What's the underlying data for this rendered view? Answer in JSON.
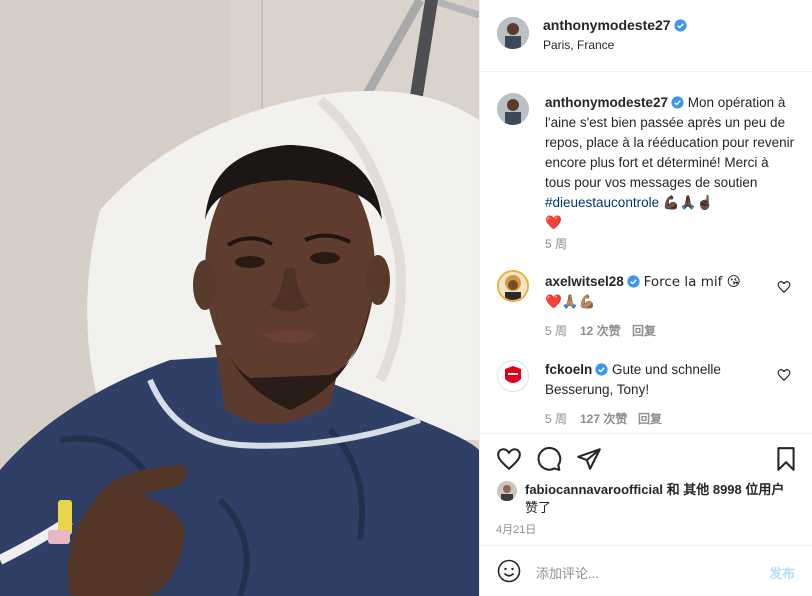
{
  "post": {
    "author": "anthonymodeste27",
    "location": "Paris, France"
  },
  "caption": {
    "author": "anthonymodeste27",
    "text": "Mon opération à l'aine s'est bien passée après un peu de repos, place à la rééducation pour revenir encore plus fort et déterminé! Merci à tous pour vos messages de soutien",
    "hashtag": "#dieuestaucontrole",
    "emojis": "💪🏿🙏🏿☝🏿",
    "emoji_line2": "❤️",
    "time": "5 周"
  },
  "comments": [
    {
      "author": "axelwitsel28",
      "text": "Force la mif 😘",
      "emojis": "❤️🙏🏽💪🏽",
      "time": "5 周",
      "likes": "12 次赞",
      "reply": "回复"
    },
    {
      "author": "fckoeln",
      "text": "Gute und schnelle Besserung, Tony!",
      "time": "5 周",
      "likes": "127 次赞",
      "reply": "回复"
    }
  ],
  "likes": {
    "liker": "fabiocannavaroofficial",
    "and_text": "和 其他 8998 位用户",
    "suffix": "赞了"
  },
  "date": "4月21日",
  "add_comment": {
    "placeholder": "添加评论...",
    "post_label": "发布"
  },
  "colors": {
    "verified_blue": "#3897f0",
    "hashtag": "#00376b",
    "publish_disabled": "#b2dffc",
    "like_red": "#ed4956"
  },
  "icons": {
    "like": "heart-icon",
    "comment": "comment-icon",
    "share": "paper-plane-icon",
    "save": "bookmark-icon",
    "emoji": "smiley-icon",
    "verified": "verified-badge-icon"
  }
}
